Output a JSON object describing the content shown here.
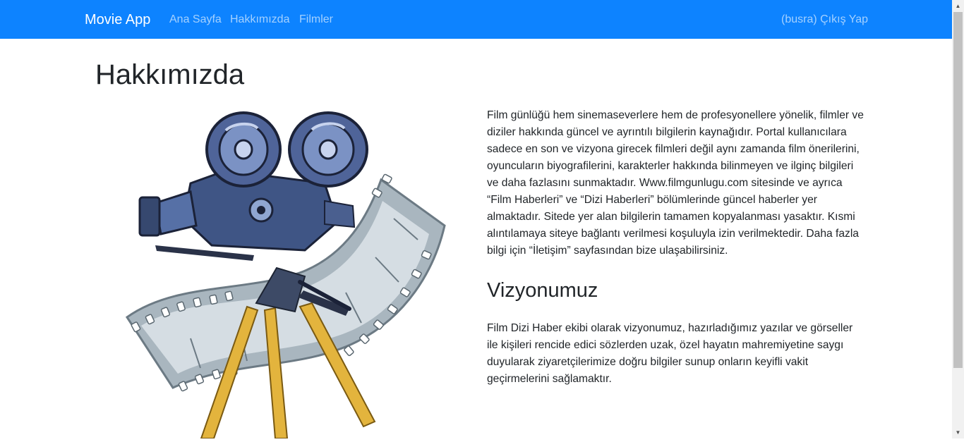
{
  "navbar": {
    "brand": "Movie App",
    "links": [
      "Ana Sayfa",
      "Hakkımızda",
      "Filmler"
    ],
    "user": "(busra) Çıkış Yap",
    "background": "#0d83ff"
  },
  "main": {
    "title": "Hakkımızda",
    "about_text": "Film günlüğü hem sinemaseverlere hem de profesyonellere yönelik, filmler ve diziler hakkında güncel ve ayrıntılı bilgilerin kaynağıdır. Portal kullanıcılara sadece en son ve vizyona girecek filmleri değil aynı zamanda film önerilerini, oyuncuların biyografilerini, karakterler hakkında bilinmeyen ve ilginç bilgileri ve daha fazlasını sunmaktadır. Www.filmgunlugu.com sitesinde ve ayrıca “Film Haberleri” ve “Dizi Haberleri” bölümlerinde güncel haberler yer almaktadır. Sitede yer alan bilgilerin tamamen kopyalanması yasaktır. Kısmi alıntılamaya siteye bağlantı verilmesi koşuluyla izin verilmektedir. Daha fazla bilgi için “İletişim” sayfasından bize ulaşabilirsiniz.",
    "vision_title": "Vizyonumuz",
    "vision_text": "Film Dizi Haber ekibi olarak vizyonumuz, hazırladığımız yazılar ve görseller ile kişileri rencide edici sözlerden uzak, özel hayatın mahremiyetine saygı duyularak ziyaretçilerimize doğru bilgiler sunup onların keyifli vakit geçirmelerini sağlamaktır.",
    "image_icon": "film-camera-illustration"
  }
}
